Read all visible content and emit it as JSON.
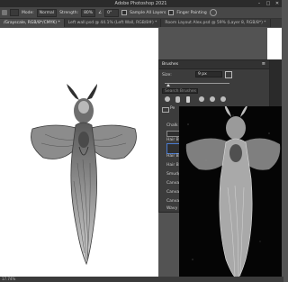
{
  "app_title": "Adobe Photoshop 2021",
  "window_controls": {
    "minimize": "–",
    "maximize": "□",
    "close": "✕"
  },
  "options_bar": {
    "mode_label": "Mode:",
    "mode_value": "Normal",
    "strength_label": "Strength:",
    "strength_value": "80%",
    "angle_label": "∠",
    "angle_value": "0°",
    "sample_all_layers": "Sample All Layers",
    "finger_painting": "Finger Painting"
  },
  "tabs": [
    {
      "label": "/Grayscale, RGB/8*/CMYK) *",
      "active": true
    },
    {
      "label": "Left wall.psd @ 44.1% (Left Wall, RGB/8#) *",
      "active": false
    },
    {
      "label": "Room Layout Alex.psd @ 59% (Layer 8, RGB/8*) *",
      "active": false
    }
  ],
  "status_bar": "17.74%",
  "brushes_panel": {
    "title": "Brushes",
    "menu_glyph": "≡",
    "size_label": "Size:",
    "size_value": "9 px",
    "search_placeholder": "Search Brushes",
    "group_label": "Pe",
    "presets": [
      "Chalk Brush",
      "Hair Brush",
      "Hair Brush",
      "Hair Brush",
      "Smudge",
      "Canvas",
      "Canvas",
      "Canvas",
      "Wavy Mix"
    ]
  }
}
